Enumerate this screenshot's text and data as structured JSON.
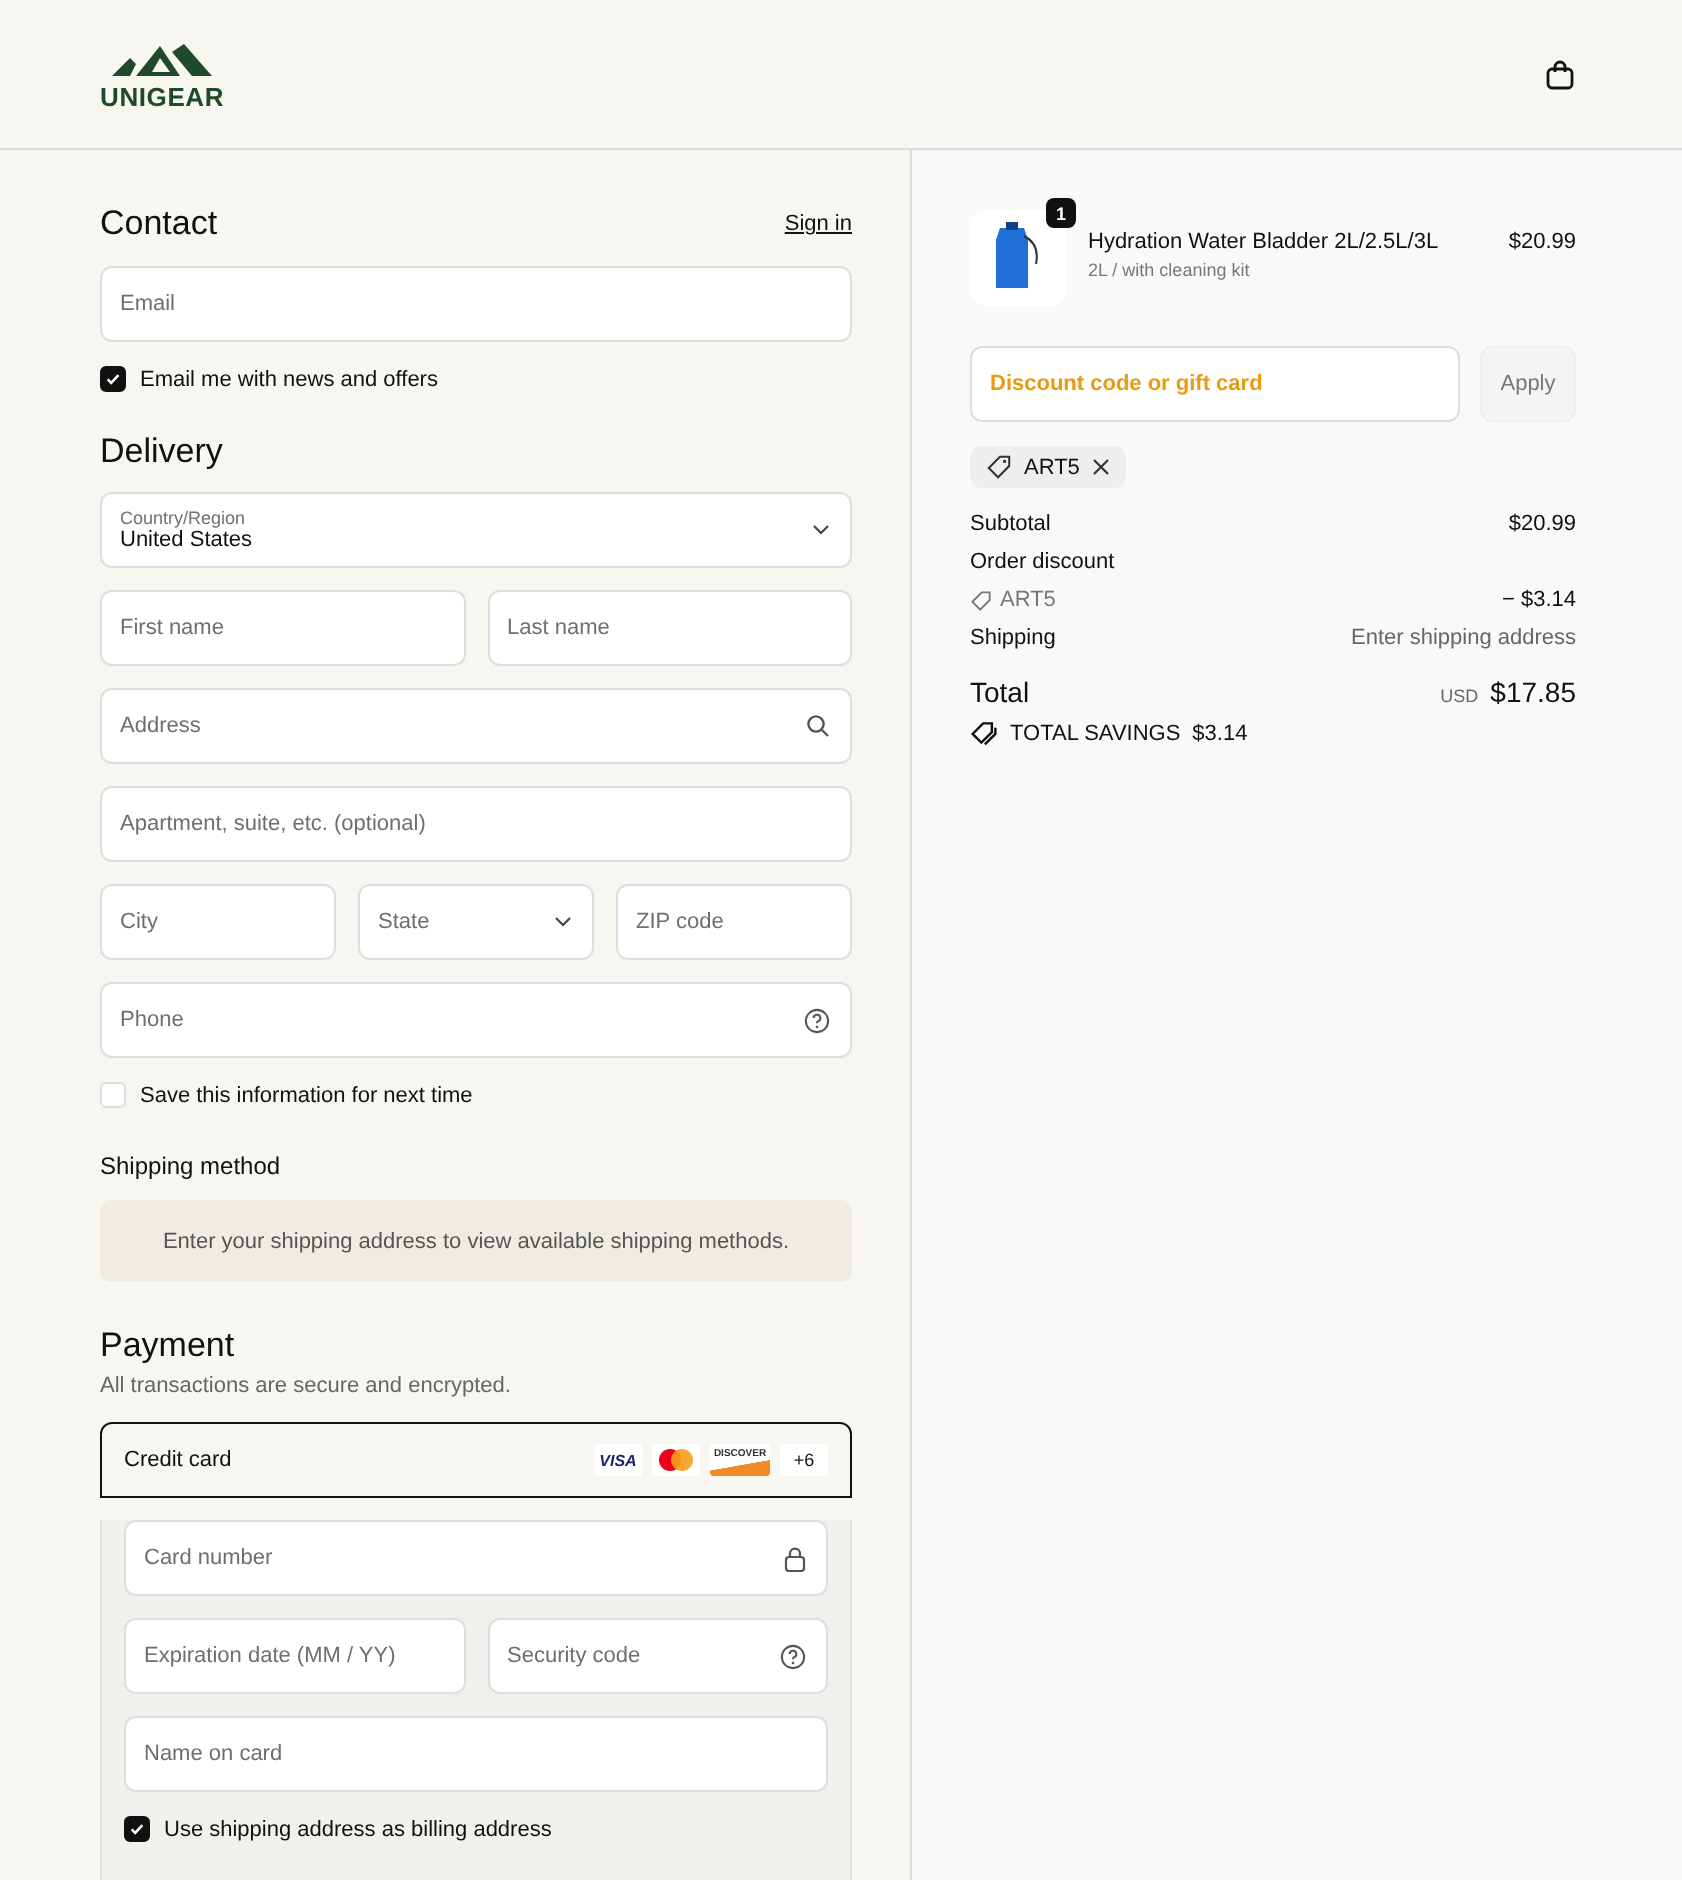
{
  "header": {
    "logo_text": "UNIGEAR"
  },
  "contact": {
    "title": "Contact",
    "sign_in": "Sign in",
    "email_placeholder": "Email",
    "newsletter": {
      "label": "Email me with news and offers",
      "checked": true
    }
  },
  "delivery": {
    "title": "Delivery",
    "country": {
      "label": "Country/Region",
      "value": "United States"
    },
    "rows": [
      [
        {
          "kind": "text",
          "placeholder": "First name"
        },
        {
          "kind": "text",
          "placeholder": "Last name"
        }
      ],
      [
        {
          "kind": "search",
          "placeholder": "Address"
        }
      ],
      [
        {
          "kind": "text",
          "placeholder": "Apartment, suite, etc. (optional)"
        }
      ],
      [
        {
          "kind": "text",
          "placeholder": "City"
        },
        {
          "kind": "select",
          "placeholder": "State"
        },
        {
          "kind": "text",
          "placeholder": "ZIP code"
        }
      ],
      [
        {
          "kind": "help",
          "placeholder": "Phone"
        }
      ]
    ],
    "save_info": {
      "label": "Save this information for next time",
      "checked": false
    }
  },
  "shipping_method": {
    "title": "Shipping method",
    "notice": "Enter your shipping address to view available shipping methods."
  },
  "payment": {
    "title": "Payment",
    "subtitle": "All transactions are secure and encrypted.",
    "method": {
      "label": "Credit card",
      "selected": true
    },
    "brands": [
      {
        "kind": "visa",
        "label": "VISA"
      },
      {
        "kind": "mastercard"
      },
      {
        "kind": "discover",
        "label": "DISCOVER"
      }
    ],
    "more_brands": "+6",
    "rows": [
      [
        {
          "kind": "lock",
          "placeholder": "Card number"
        }
      ],
      [
        {
          "kind": "text",
          "placeholder": "Expiration date (MM / YY)"
        },
        {
          "kind": "help",
          "placeholder": "Security code"
        }
      ],
      [
        {
          "kind": "text",
          "placeholder": "Name on card"
        }
      ]
    ],
    "billing": {
      "label": "Use shipping address as billing address",
      "checked": true
    }
  },
  "summary": {
    "items": [
      {
        "name": "Hydration Water Bladder 2L/2.5L/3L",
        "variant": "2L / with cleaning kit",
        "price": "$20.99",
        "quantity": "1"
      }
    ],
    "discount": {
      "placeholder": "Discount code or gift card",
      "button": "Apply"
    },
    "applied_code": "ART5",
    "lines": [
      {
        "kind": "row",
        "label": "Subtotal",
        "value": "$20.99"
      },
      {
        "kind": "heading",
        "label": "Order discount"
      },
      {
        "kind": "code",
        "label": "ART5",
        "value": "− $3.14"
      },
      {
        "kind": "muted",
        "label": "Shipping",
        "value": "Enter shipping address"
      }
    ],
    "total": {
      "label": "Total",
      "currency": "USD",
      "amount": "$17.85"
    },
    "savings": {
      "label": "TOTAL SAVINGS",
      "amount": "$3.14"
    }
  }
}
